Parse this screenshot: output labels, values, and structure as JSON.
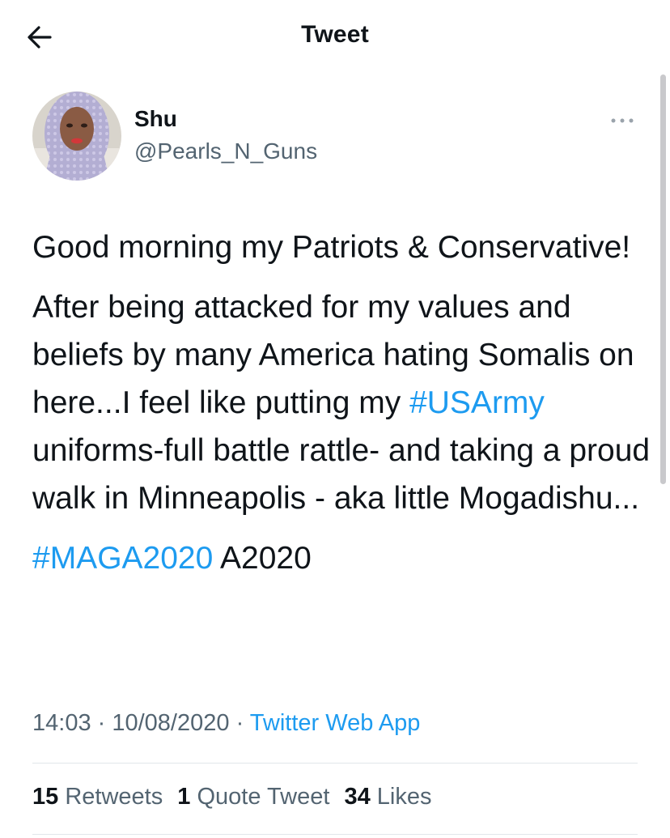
{
  "header": {
    "title": "Tweet",
    "back_icon": "arrow-left-icon"
  },
  "author": {
    "display_name": "Shu",
    "handle": "@Pearls_N_Guns",
    "more_icon": "more-horizontal-icon"
  },
  "tweet": {
    "paragraph1": "Good morning my Patriots & Conservative!",
    "paragraph2_before": "After being attacked for my values and beliefs by many America hating Somalis on here...I feel like putting my ",
    "paragraph2_hashtag": "#USArmy",
    "paragraph2_after": " uniforms-full battle rattle- and taking a proud walk in Minneapolis - aka little Mogadishu...",
    "paragraph3_hashtag": "#MAGA2020",
    "paragraph3_after": " A2020"
  },
  "meta": {
    "time": "14:03",
    "separator": " · ",
    "date": "10/08/2020",
    "source": "Twitter Web App"
  },
  "stats": {
    "retweets_count": "15",
    "retweets_label": "Retweets",
    "quotes_count": "1",
    "quotes_label": "Quote Tweet",
    "likes_count": "34",
    "likes_label": "Likes"
  },
  "colors": {
    "link": "#1d9bf0",
    "text": "#0f1419",
    "secondary": "#536471"
  }
}
